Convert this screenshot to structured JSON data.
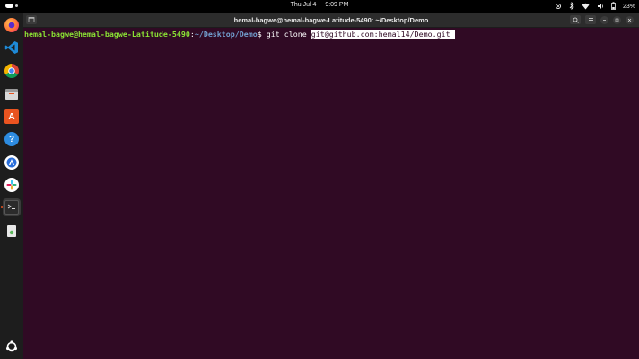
{
  "topbar": {
    "date": "Thu Jul 4",
    "time": "9:09 PM",
    "battery": "23%",
    "icons": [
      "activities-indicator",
      "network-icon",
      "bluetooth-icon",
      "wifi-icon",
      "volume-icon",
      "battery-icon"
    ]
  },
  "dock": {
    "apps": [
      "firefox",
      "vscode",
      "chrome",
      "files",
      "app-center",
      "help",
      "software-updater",
      "slack",
      "terminal",
      "trash"
    ],
    "active_app": "terminal",
    "show_apps_icon": "ubuntu-apps-icon"
  },
  "window": {
    "title": "hemal-bagwe@hemal-bagwe-Latitude-5490: ~/Desktop/Demo"
  },
  "terminal": {
    "user_host": "hemal-bagwe@hemal-bagwe-Latitude-5490",
    "separator": ":",
    "path": "~/Desktop/Demo",
    "prompt_symbol": "$",
    "command": " git clone ",
    "selected_text": "git@github.com:hemal14/Demo.git"
  },
  "colors": {
    "terminal_bg": "#300a24",
    "prompt_user": "#8ae234",
    "prompt_path": "#729fcf",
    "accent": "#e95420"
  }
}
